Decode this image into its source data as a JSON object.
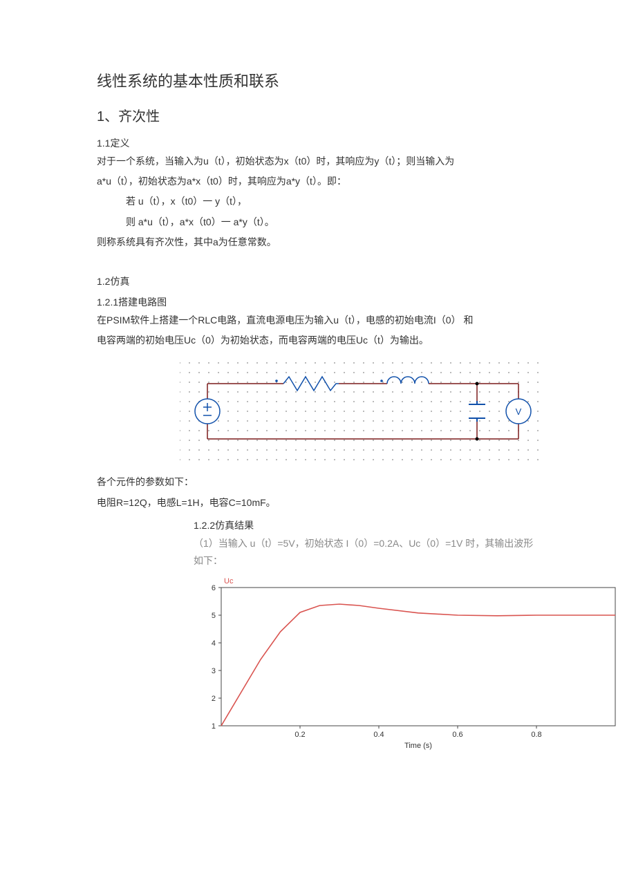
{
  "title": "线性系统的基本性质和联系",
  "section1": {
    "heading": "1、齐次性",
    "s1_1_heading": "1.1定义",
    "p1": "对于一个系统，当输入为u（t），初始状态为x（t0）时，其响应为y（t）；则当输入为",
    "p2": "a*u（t），初始状态为a*x（t0）时，其响应为a*y（t）。即：",
    "p3": "若 u（t），x（t0）一 y（t），",
    "p4": "则 a*u（t），a*x（t0）一 a*y（t）。",
    "p5": "则称系统具有齐次性，其中a为任意常数。",
    "s1_2_heading": "1.2仿真",
    "s1_2_1_heading": "1.2.1搭建电路图",
    "p6": "在PSIM软件上搭建一个RLC电路，直流电源电压为输入u（t），电感的初始电流I（0） 和",
    "p7": "电容两端的初始电压Uc（0）为初始状态，而电容两端的电压Uc（t）为输出。",
    "p8": "各个元件的参数如下：",
    "p9": "电阻R=12Q，电感L=1H，电容C=10mF。",
    "s1_2_2_heading": "1.2.2仿真结果",
    "p10": "（1）当输入 u（t）=5V，初始状态 I（0）=0.2A、Uc（0）=1V 时，其输出波形如下："
  },
  "chart_data": {
    "type": "line",
    "title": "Uc",
    "xlabel": "Time (s)",
    "ylabel": "",
    "xlim": [
      0,
      1.0
    ],
    "ylim": [
      1,
      6
    ],
    "x_ticks": [
      0.2,
      0.4,
      0.6,
      0.8
    ],
    "y_ticks": [
      1,
      2,
      3,
      4,
      5,
      6
    ],
    "series": [
      {
        "name": "Uc",
        "color": "#d9534f",
        "x": [
          0.0,
          0.05,
          0.1,
          0.15,
          0.2,
          0.25,
          0.3,
          0.35,
          0.4,
          0.5,
          0.6,
          0.7,
          0.8,
          0.9,
          1.0
        ],
        "values": [
          1.0,
          2.2,
          3.4,
          4.4,
          5.1,
          5.35,
          5.4,
          5.35,
          5.25,
          5.08,
          5.0,
          4.98,
          5.0,
          5.0,
          5.0
        ]
      }
    ]
  }
}
